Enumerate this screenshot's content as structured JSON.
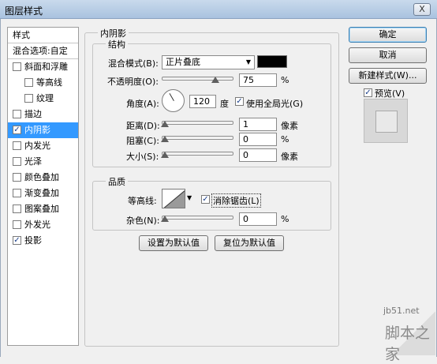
{
  "window": {
    "title": "图层样式",
    "close_label": "X"
  },
  "style_list": {
    "items": [
      {
        "label": "样式",
        "has_checkbox": false,
        "checked": false,
        "indent": false,
        "selected": false,
        "separator": true
      },
      {
        "label": "混合选项:自定",
        "has_checkbox": false,
        "checked": false,
        "indent": false,
        "selected": false,
        "separator": true
      },
      {
        "label": "斜面和浮雕",
        "has_checkbox": true,
        "checked": false,
        "indent": false,
        "selected": false
      },
      {
        "label": "等高线",
        "has_checkbox": true,
        "checked": false,
        "indent": true,
        "selected": false
      },
      {
        "label": "纹理",
        "has_checkbox": true,
        "checked": false,
        "indent": true,
        "selected": false
      },
      {
        "label": "描边",
        "has_checkbox": true,
        "checked": false,
        "indent": false,
        "selected": false
      },
      {
        "label": "内阴影",
        "has_checkbox": true,
        "checked": true,
        "indent": false,
        "selected": true
      },
      {
        "label": "内发光",
        "has_checkbox": true,
        "checked": false,
        "indent": false,
        "selected": false
      },
      {
        "label": "光泽",
        "has_checkbox": true,
        "checked": false,
        "indent": false,
        "selected": false
      },
      {
        "label": "颜色叠加",
        "has_checkbox": true,
        "checked": false,
        "indent": false,
        "selected": false
      },
      {
        "label": "渐变叠加",
        "has_checkbox": true,
        "checked": false,
        "indent": false,
        "selected": false
      },
      {
        "label": "图案叠加",
        "has_checkbox": true,
        "checked": false,
        "indent": false,
        "selected": false
      },
      {
        "label": "外发光",
        "has_checkbox": true,
        "checked": false,
        "indent": false,
        "selected": false
      },
      {
        "label": "投影",
        "has_checkbox": true,
        "checked": true,
        "indent": false,
        "selected": false
      }
    ]
  },
  "panel": {
    "title": "内阴影",
    "structure": {
      "title": "结构",
      "blend_mode_label": "混合模式(B):",
      "blend_mode_value": "正片叠底",
      "shadow_color": "#000000",
      "opacity_label": "不透明度(O):",
      "opacity_value": "75",
      "opacity_unit": "%",
      "opacity_level": 0.75,
      "angle_label": "角度(A):",
      "angle_value": "120",
      "angle_unit": "度",
      "global_light_label": "使用全局光(G)",
      "global_light_checked": true,
      "distance_label": "距离(D):",
      "distance_value": "1",
      "distance_unit": "像素",
      "choke_label": "阻塞(C):",
      "choke_value": "0",
      "choke_unit": "%",
      "size_label": "大小(S):",
      "size_value": "0",
      "size_unit": "像素"
    },
    "quality": {
      "title": "品质",
      "contour_label": "等高线:",
      "antialias_label": "消除锯齿(L)",
      "antialias_checked": true,
      "noise_label": "杂色(N):",
      "noise_value": "0",
      "noise_unit": "%"
    },
    "default_button": "设置为默认值",
    "reset_button": "复位为默认值"
  },
  "right": {
    "ok_button": "确定",
    "cancel_button": "取消",
    "new_style_button": "新建样式(W)...",
    "preview_label": "预览(V)",
    "preview_checked": true
  },
  "watermark": {
    "line1": "jb51.net",
    "line2": "脚本之家"
  }
}
